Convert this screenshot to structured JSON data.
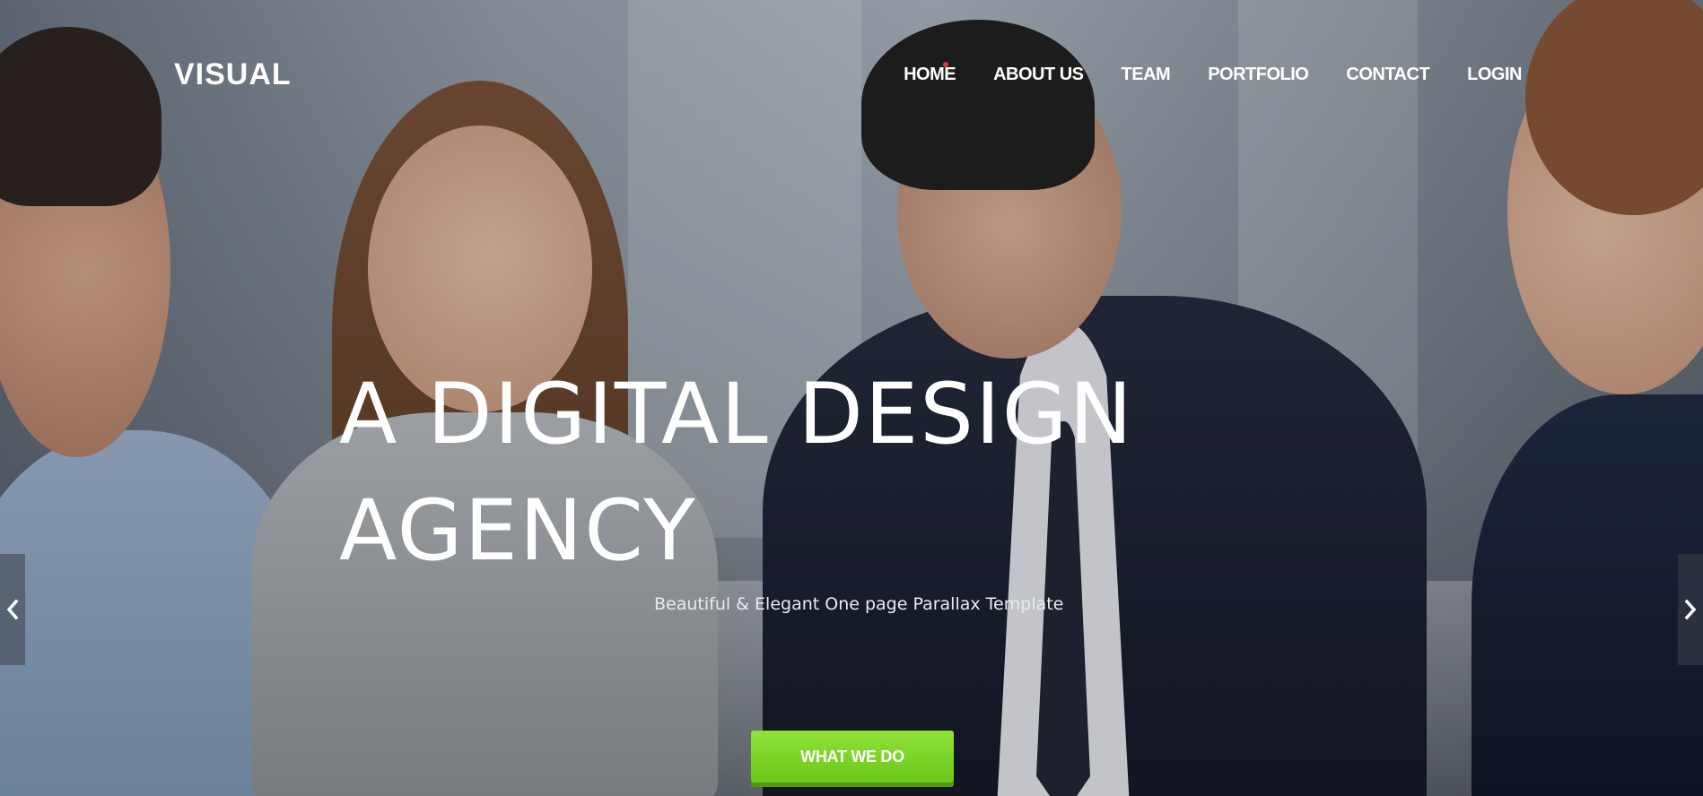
{
  "header": {
    "logo": "VISUAL",
    "nav": [
      {
        "label": "HOME",
        "active": true
      },
      {
        "label": "ABOUT US"
      },
      {
        "label": "TEAM"
      },
      {
        "label": "PORTFOLIO"
      },
      {
        "label": "CONTACT"
      },
      {
        "label": "LOGIN"
      }
    ]
  },
  "hero": {
    "headline_line1": "A DIGITAL DESIGN",
    "headline_line2": "AGENCY",
    "subtitle": "Beautiful & Elegant One page Parallax Template",
    "cta_label": "WHAT WE DO"
  },
  "slider": {
    "prev_icon": "chevron-left-icon",
    "next_icon": "chevron-right-icon"
  },
  "colors": {
    "cta": "#7ed62a",
    "active_dot": "#e8343b"
  }
}
